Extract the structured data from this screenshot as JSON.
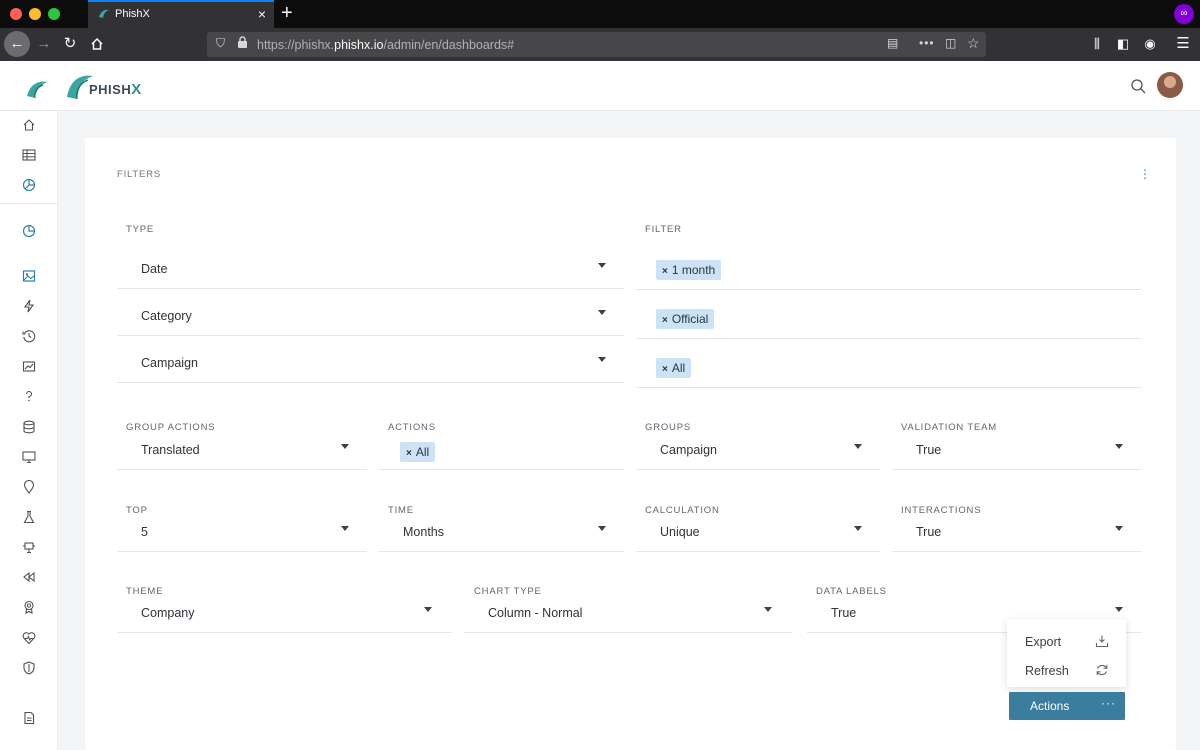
{
  "browser": {
    "tab_title": "PhishX",
    "url_prefix": "https://phishx.",
    "url_domain": "phishx.io",
    "url_path": "/admin/en/dashboards#"
  },
  "app": {
    "logo_text": "PHISH",
    "logo_accent": "X",
    "brand_color": "#2f8f8a",
    "accent_color": "#3b7d9e"
  },
  "sidebar": {
    "top_icons": [
      "home-icon",
      "table-icon",
      "dashboard-icon"
    ],
    "active_icon": "dashboard-icon",
    "icons": [
      "chart-pie-icon",
      "image-icon",
      "lightning-icon",
      "history-icon",
      "reports-icon",
      "help-icon",
      "database-icon",
      "monitor-icon",
      "map-pin-icon",
      "lab-icon",
      "network-icon",
      "rewind-icon",
      "award-icon",
      "health-icon",
      "shield-icon",
      "document-icon"
    ]
  },
  "filters": {
    "title": "FILTERS",
    "type_header": "TYPE",
    "filter_header": "FILTER",
    "rows": [
      {
        "type": "Date",
        "chip": "1 month"
      },
      {
        "type": "Category",
        "chip": "Official"
      },
      {
        "type": "Campaign",
        "chip": "All"
      }
    ],
    "group_actions": {
      "label": "GROUP ACTIONS",
      "value": "Translated"
    },
    "actions": {
      "label": "ACTIONS",
      "chip": "All"
    },
    "groups": {
      "label": "GROUPS",
      "value": "Campaign"
    },
    "validation_team": {
      "label": "VALIDATION TEAM",
      "value": "True"
    },
    "top": {
      "label": "TOP",
      "value": "5"
    },
    "time": {
      "label": "TIME",
      "value": "Months"
    },
    "calculation": {
      "label": "CALCULATION",
      "value": "Unique"
    },
    "interactions": {
      "label": "INTERACTIONS",
      "value": "True"
    },
    "theme": {
      "label": "THEME",
      "value": "Company"
    },
    "chart_type": {
      "label": "CHART TYPE",
      "value": "Column - Normal"
    },
    "data_labels": {
      "label": "DATA LABELS",
      "value": "True"
    }
  },
  "menu": {
    "export": "Export",
    "refresh": "Refresh",
    "actions": "Actions",
    "actions_dots": "···"
  }
}
